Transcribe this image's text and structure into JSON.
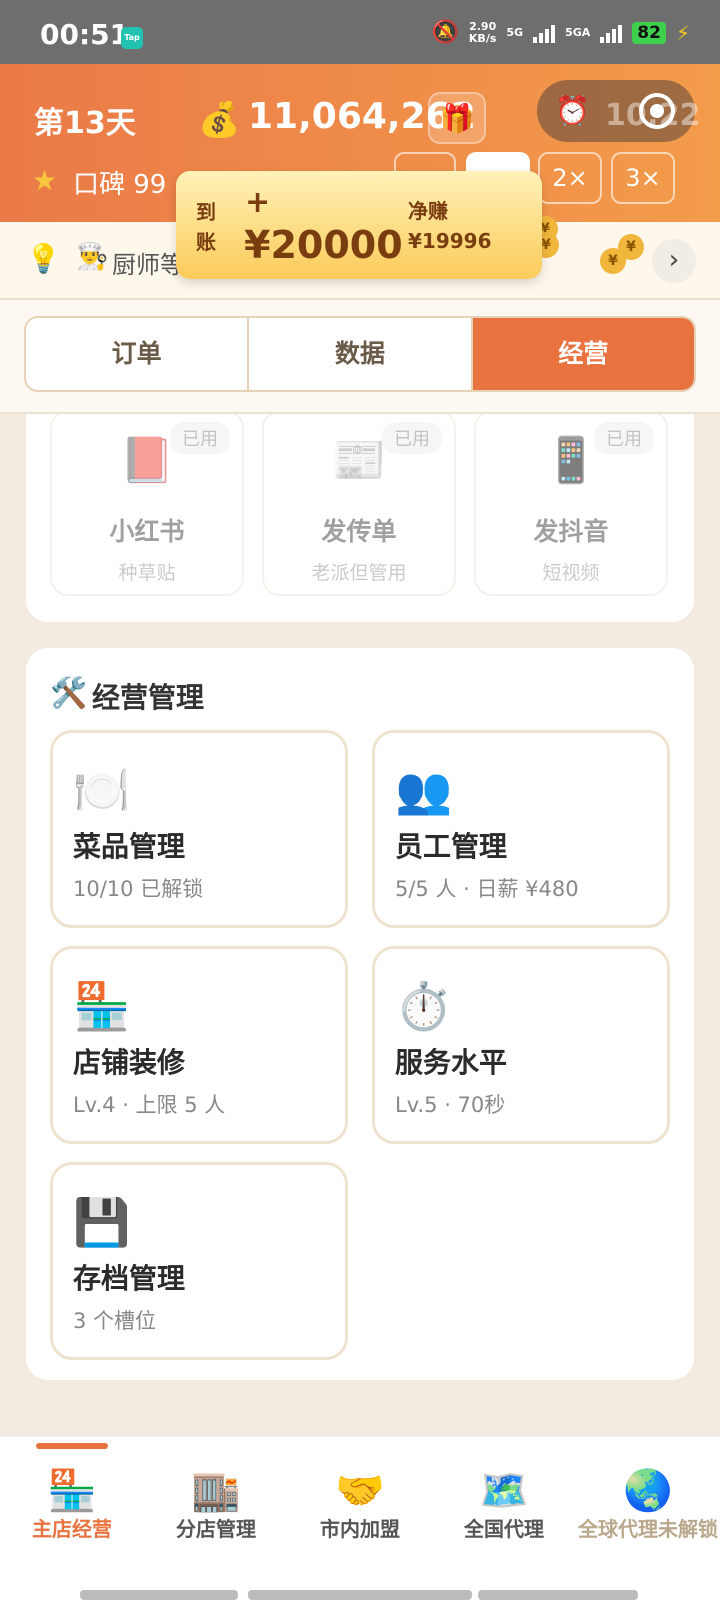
{
  "status_bar": {
    "time": "00:51",
    "app_badge": "Tap",
    "speed_top": "2.90",
    "speed_unit": "KB/s",
    "net1": "5G",
    "net2": "5GA",
    "battery": "82"
  },
  "header": {
    "day": "第13天",
    "money": "11,064,262",
    "reputation": "口碑 99",
    "timer": "10:22",
    "speed_buttons": [
      "2×",
      "3×"
    ]
  },
  "toast": {
    "arrival_label": "到账",
    "plus": "+",
    "amount": "¥20000",
    "net_label": "净赚",
    "net_amount": "¥19996"
  },
  "ticker": {
    "text": "厨师等",
    "coin_symbol": "¥"
  },
  "tabs": [
    {
      "label": "订单",
      "active": false
    },
    {
      "label": "数据",
      "active": false
    },
    {
      "label": "经营",
      "active": true
    }
  ],
  "promotions": [
    {
      "title": "小红书",
      "subtitle": "种草贴",
      "badge": "已用",
      "icon": "book-icon"
    },
    {
      "title": "发传单",
      "subtitle": "老派但管用",
      "badge": "已用",
      "icon": "newspaper-icon"
    },
    {
      "title": "发抖音",
      "subtitle": "短视频",
      "badge": "已用",
      "icon": "phone-icon"
    }
  ],
  "management": {
    "title": "经营管理",
    "cards": [
      {
        "title": "菜品管理",
        "subtitle": "10/10 已解锁",
        "icon": "plate-icon"
      },
      {
        "title": "员工管理",
        "subtitle": "5/5 人 · 日薪 ¥480",
        "icon": "people-icon"
      },
      {
        "title": "店铺装修",
        "subtitle": "Lv.4 · 上限 5 人",
        "icon": "store-icon"
      },
      {
        "title": "服务水平",
        "subtitle": "Lv.5 · 70秒",
        "icon": "stopwatch-icon"
      },
      {
        "title": "存档管理",
        "subtitle": "3 个槽位",
        "icon": "floppy-icon"
      }
    ]
  },
  "bottom_nav": [
    {
      "label": "主店经营",
      "icon": "store-icon",
      "state": "active"
    },
    {
      "label": "分店管理",
      "icon": "building-icon",
      "state": "normal"
    },
    {
      "label": "市内加盟",
      "icon": "handshake-icon",
      "state": "normal"
    },
    {
      "label": "全国代理",
      "icon": "map-icon",
      "state": "normal"
    },
    {
      "label": "全球代理未解锁",
      "icon": "globe-icon",
      "state": "locked"
    }
  ],
  "colors": {
    "accent": "#e9733f",
    "header_start": "#ea7a48",
    "header_end": "#f39c4a",
    "toast": "#fbcb5a"
  }
}
